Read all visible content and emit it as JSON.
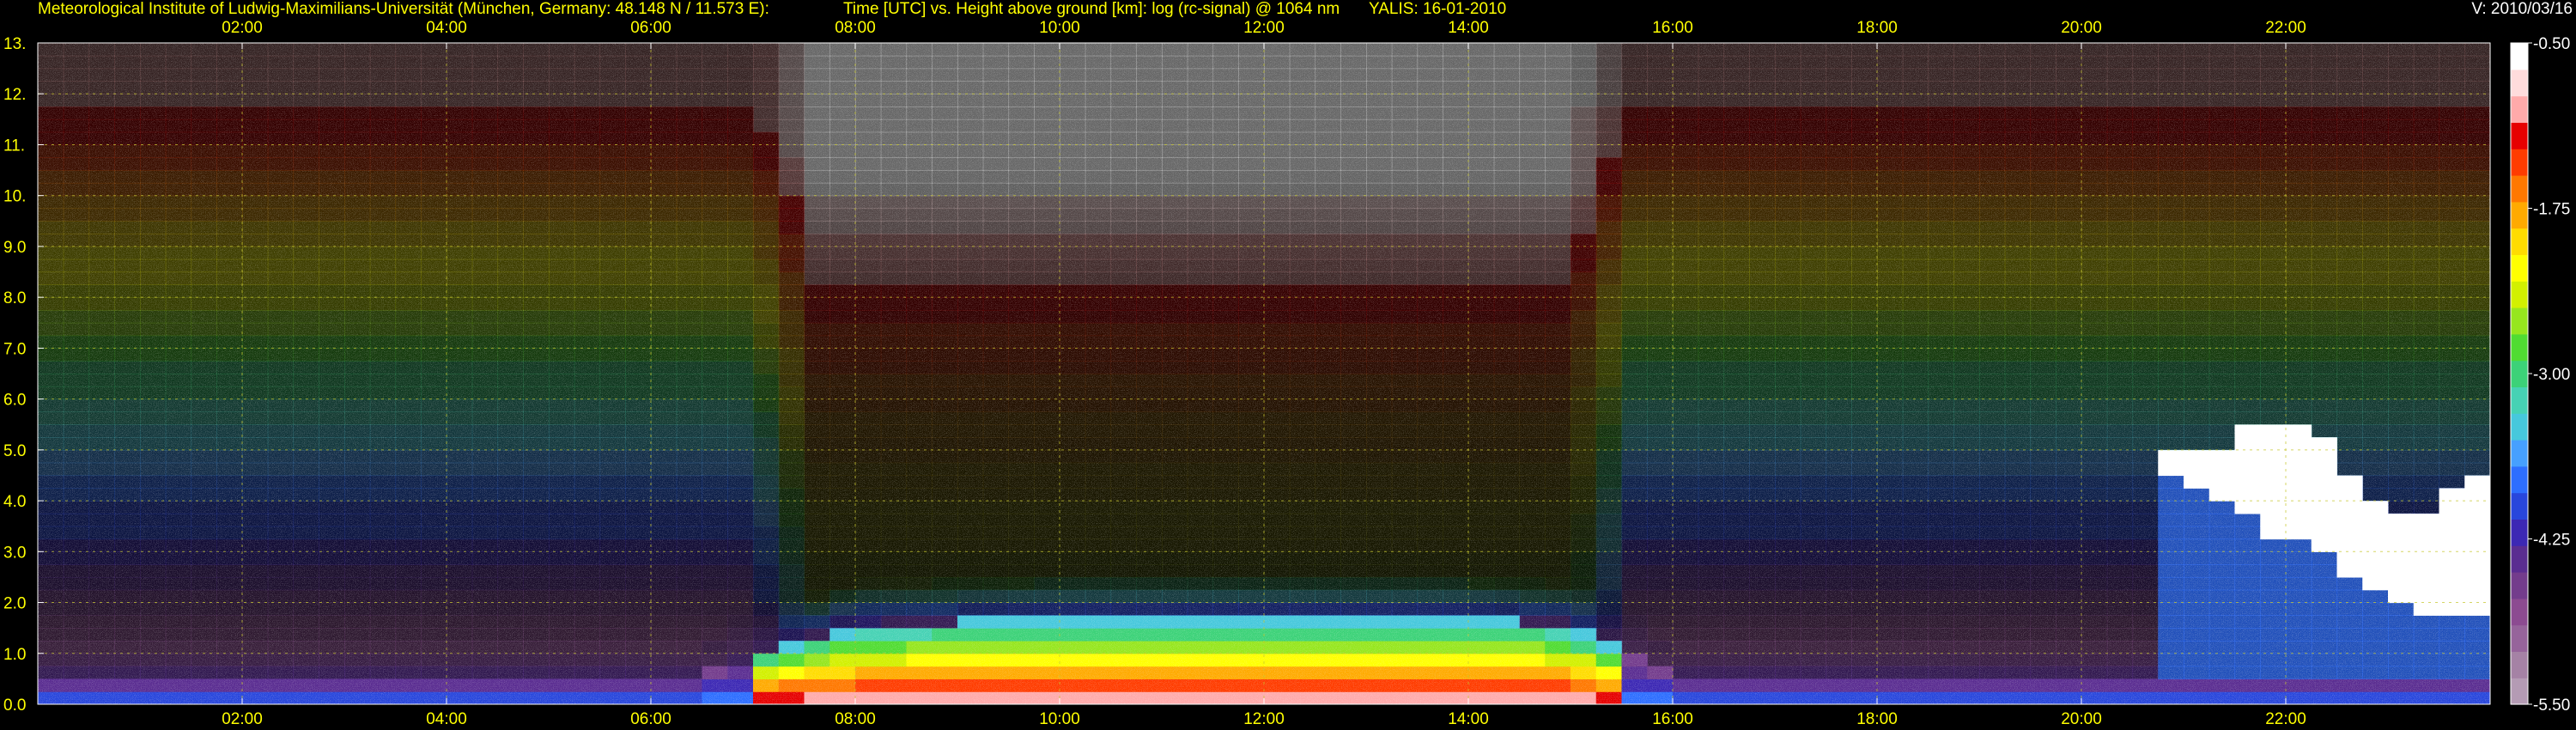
{
  "header": {
    "institute": "Meteorological Institute of Ludwig-Maximilians-Universität (München, Germany: 48.148 N / 11.573 E):",
    "plot_description": "Time [UTC] vs. Height above ground [km]: log (rc-signal) @ 1064 nm",
    "instrument_date": "YALIS: 16-01-2010",
    "version": "V: 2010/03/16"
  },
  "colors": {
    "background": "#000000",
    "tick_text": "#ffff00",
    "grid": "#c8c832",
    "colorbar_text": "#ffffff"
  },
  "chart_data": {
    "type": "heatmap",
    "title": "Time [UTC] vs. Height above ground [km]: log (rc-signal) @ 1064 nm",
    "x_axis": {
      "unit": "UTC hour",
      "range": [
        0.0,
        24.0
      ],
      "tick_values": [
        2,
        4,
        6,
        8,
        10,
        12,
        14,
        16,
        18,
        20,
        22
      ],
      "tick_labels": [
        "02:00",
        "04:00",
        "06:00",
        "08:00",
        "10:00",
        "12:00",
        "14:00",
        "16:00",
        "18:00",
        "20:00",
        "22:00"
      ],
      "position": "top and bottom"
    },
    "y_axis": {
      "unit": "km",
      "range": [
        0.0,
        13.0
      ],
      "tick_values": [
        0,
        1,
        2,
        3,
        4,
        5,
        6,
        7,
        8,
        9,
        10,
        11,
        12,
        13
      ],
      "tick_labels": [
        "0.0",
        "1.0",
        "2.0",
        "3.0",
        "4.0",
        "5.0",
        "6.0",
        "7.0",
        "8.0",
        "9.0",
        "10.",
        "11.",
        "12.",
        "13."
      ]
    },
    "grid": true,
    "colorbar": {
      "position": "right",
      "range": [
        -5.5,
        -0.5
      ],
      "tick_values": [
        -0.5,
        -1.75,
        -3.0,
        -4.25,
        -5.5
      ],
      "tick_labels": [
        "-0.50",
        "-1.75",
        "-3.00",
        "-4.25",
        "-5.50"
      ],
      "colors": [
        "#b49bb4",
        "#a582a5",
        "#96649b",
        "#8c4b91",
        "#733c8c",
        "#5a2d91",
        "#3c28b4",
        "#2846dc",
        "#2d6eff",
        "#46a0ff",
        "#46c8dc",
        "#46d2b4",
        "#3cd278",
        "#50dc32",
        "#96e61e",
        "#d2f000",
        "#ffff00",
        "#ffdc00",
        "#ffaa00",
        "#ff7800",
        "#ff3c00",
        "#e60000",
        "#ffaaaa",
        "#ffdcdc",
        "#ffffff"
      ]
    },
    "features": {
      "boundary_layer_top_km": [
        {
          "t": 0.0,
          "h": 0.55
        },
        {
          "t": 5.0,
          "h": 0.55
        },
        {
          "t": 6.5,
          "h": 0.6
        },
        {
          "t": 7.0,
          "h": 0.95
        },
        {
          "t": 8.0,
          "h": 1.55
        },
        {
          "t": 10.0,
          "h": 1.7
        },
        {
          "t": 12.0,
          "h": 1.7
        },
        {
          "t": 14.0,
          "h": 1.7
        },
        {
          "t": 15.0,
          "h": 1.55
        },
        {
          "t": 15.6,
          "h": 0.9
        },
        {
          "t": 16.0,
          "h": 0.6
        },
        {
          "t": 20.5,
          "h": 0.55
        },
        {
          "t": 24.0,
          "h": 0.55
        }
      ],
      "daytime_noise_hours": [
        7.0,
        15.6
      ],
      "cloud_base_km": [
        {
          "t": 20.7,
          "h": 4.6
        },
        {
          "t": 21.2,
          "h": 4.2
        },
        {
          "t": 21.8,
          "h": 3.4
        },
        {
          "t": 22.3,
          "h": 3.1
        },
        {
          "t": 22.8,
          "h": 2.3
        },
        {
          "t": 23.2,
          "h": 1.9
        },
        {
          "t": 23.8,
          "h": 1.8
        }
      ],
      "cloud_top_km": [
        {
          "t": 20.7,
          "h": 5.2
        },
        {
          "t": 21.2,
          "h": 4.9
        },
        {
          "t": 21.8,
          "h": 5.6
        },
        {
          "t": 22.3,
          "h": 5.3
        },
        {
          "t": 22.8,
          "h": 4.2
        },
        {
          "t": 23.2,
          "h": 3.5
        },
        {
          "t": 23.8,
          "h": 4.6
        }
      ]
    }
  }
}
